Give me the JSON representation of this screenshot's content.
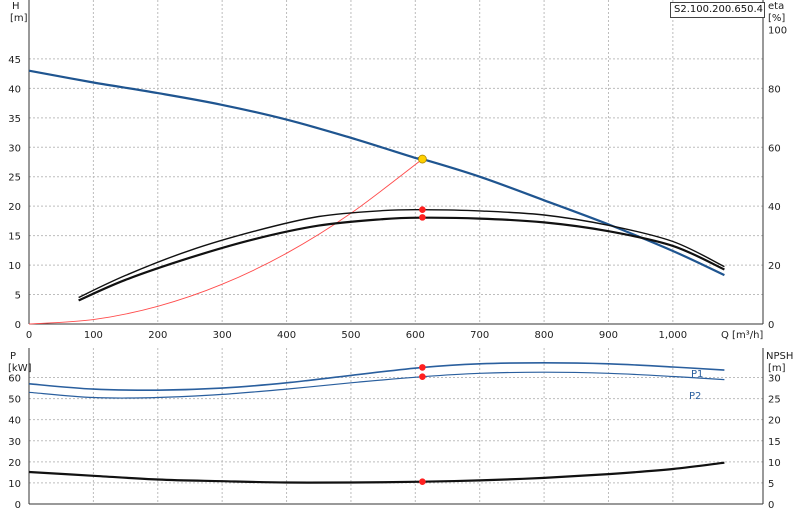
{
  "model": "S2.100.200.650.4.",
  "colors": {
    "head_curve": "#1f5590",
    "system_curve": "#ff4c4c",
    "efficiency_curves": "#111111",
    "power_curves": "#2a5f9e",
    "npsh_curve": "#111111",
    "duty_point": "#ff2020",
    "operating_point": "#ffd000",
    "grid": "#bdbdbd"
  },
  "labels": {
    "top_left_axis": "H",
    "top_left_unit": "[m]",
    "top_right_axis": "eta",
    "top_right_unit": "[%]",
    "x_axis": "Q [m³/h]",
    "bottom_left_axis": "P",
    "bottom_left_unit": "[kW]",
    "bottom_right_axis": "NPSH",
    "bottom_right_unit": "[m]",
    "p1": "P1",
    "p2": "P2"
  },
  "chart_data": [
    {
      "type": "line",
      "panel": "head-efficiency",
      "x_ticks": [
        "0",
        "100",
        "200",
        "300",
        "400",
        "500",
        "600",
        "700",
        "800",
        "900",
        "1,000"
      ],
      "y_left_ticks": [
        "0",
        "5",
        "10",
        "15",
        "20",
        "25",
        "30",
        "35",
        "40",
        "45"
      ],
      "y_right_ticks": [
        "0",
        "20",
        "40",
        "60",
        "80",
        "100"
      ],
      "xlim": [
        0,
        1140
      ],
      "ylim_left": [
        0,
        55
      ],
      "ylim_right": [
        0,
        110
      ],
      "grid": true,
      "series": [
        {
          "key": "head",
          "axis": "left",
          "x": [
            0,
            100,
            200,
            300,
            400,
            500,
            600,
            611,
            700,
            800,
            900,
            1000,
            1080
          ],
          "y": [
            43,
            41,
            39.2,
            37.2,
            34.7,
            31.6,
            28.2,
            28,
            25,
            21,
            16.9,
            12.4,
            8.3
          ]
        },
        {
          "key": "system",
          "axis": "left",
          "x": [
            0,
            100,
            200,
            300,
            400,
            500,
            611
          ],
          "y": [
            0,
            0.75,
            3,
            6.75,
            12,
            18.8,
            28
          ]
        },
        {
          "key": "eta_max",
          "axis": "right",
          "x": [
            77,
            150,
            250,
            350,
            450,
            550,
            611,
            700,
            800,
            900,
            1000,
            1080
          ],
          "y": [
            9,
            16.5,
            25,
            31.5,
            36.5,
            38.5,
            38.8,
            38.4,
            37,
            33.5,
            28,
            19.5
          ]
        },
        {
          "key": "eta_duty",
          "axis": "right",
          "x": [
            77,
            150,
            250,
            350,
            450,
            550,
            611,
            700,
            800,
            900,
            1000,
            1080
          ],
          "y": [
            8,
            15,
            22.5,
            28.8,
            33.4,
            35.6,
            36.1,
            35.8,
            34.5,
            31.5,
            26.5,
            18.5
          ]
        }
      ],
      "duty_points": [
        {
          "x": 611,
          "y": 19.4
        },
        {
          "x": 611,
          "y": 18.1
        }
      ],
      "operating_point": {
        "x": 611,
        "y": 28
      }
    },
    {
      "type": "line",
      "panel": "power-npsh",
      "x_ticks": [
        "0",
        "100",
        "200",
        "300",
        "400",
        "500",
        "600",
        "700",
        "800",
        "900",
        "1,000"
      ],
      "y_left_ticks": [
        "0",
        "10",
        "20",
        "30",
        "40",
        "50",
        "60"
      ],
      "y_right_ticks": [
        "0",
        "5",
        "10",
        "15",
        "20",
        "25",
        "30"
      ],
      "xlim": [
        0,
        1140
      ],
      "ylim_left": [
        0,
        74
      ],
      "ylim_right": [
        0,
        37
      ],
      "grid": true,
      "series": [
        {
          "key": "p1",
          "name": "P1",
          "axis": "left",
          "x": [
            0,
            100,
            200,
            300,
            400,
            500,
            611,
            700,
            800,
            900,
            1000,
            1080
          ],
          "y": [
            57,
            54.5,
            54,
            55,
            57.5,
            61,
            64.8,
            66.5,
            67,
            66.5,
            65,
            63.5
          ]
        },
        {
          "key": "p2",
          "name": "P2",
          "axis": "left",
          "x": [
            0,
            100,
            200,
            300,
            400,
            500,
            611,
            700,
            800,
            900,
            1000,
            1080
          ],
          "y": [
            53,
            50.5,
            50.5,
            52,
            54.5,
            57.5,
            60.4,
            62,
            62.5,
            62,
            60.5,
            59
          ]
        },
        {
          "key": "npsh",
          "axis": "right",
          "x": [
            0,
            100,
            200,
            300,
            400,
            500,
            611,
            700,
            800,
            900,
            1000,
            1080
          ],
          "y": [
            7.6,
            6.7,
            5.8,
            5.4,
            5.1,
            5.1,
            5.3,
            5.6,
            6.2,
            7.1,
            8.3,
            9.8
          ]
        }
      ],
      "duty_points": [
        {
          "x": 611,
          "y": 64.8,
          "axis": "left"
        },
        {
          "x": 611,
          "y": 60.4,
          "axis": "left"
        },
        {
          "x": 611,
          "y": 5.3,
          "axis": "right"
        }
      ]
    }
  ]
}
